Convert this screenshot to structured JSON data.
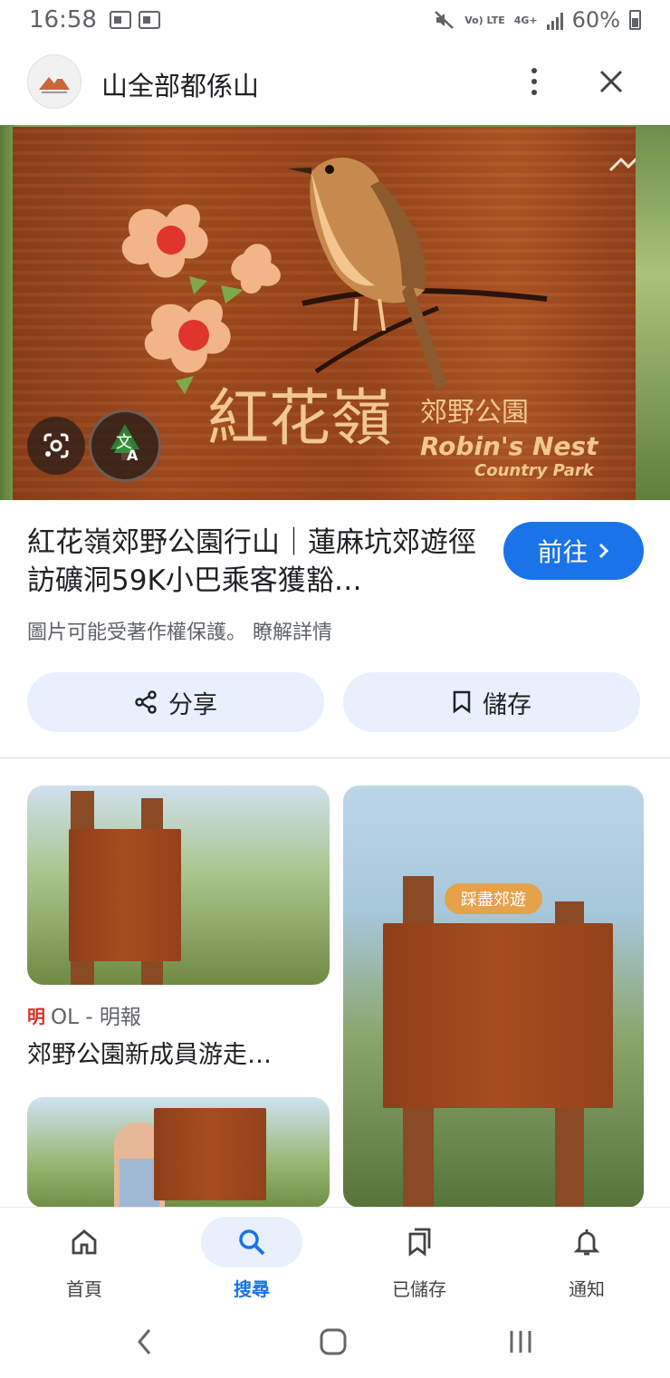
{
  "status_bar": {
    "time": "16:58",
    "lte_label": "Vo) LTE",
    "net_label": "4G+",
    "battery": "60%"
  },
  "header": {
    "site_name": "山全部都係山",
    "icons": [
      "site-logo-icon",
      "more-vert-icon",
      "close-icon"
    ]
  },
  "hero": {
    "image_alt": "紅花嶺郊野公園 Robin's Nest Country Park wooden sign",
    "sign_title_cn": "紅花嶺",
    "sign_sub_cn": "郊野公園",
    "sign_en_1": "Robin's Nest",
    "sign_en_2": "Country Park",
    "lens_icon": "google-lens-icon",
    "translate_icon": "translate-icon"
  },
  "result": {
    "title": "紅花嶺郊野公園行山｜蓮麻坑郊遊徑訪礦洞59K小巴乘客獲豁…",
    "visit_label": "前往",
    "copyright_text": "圖片可能受著作權保護。",
    "learn_more": "瞭解詳情"
  },
  "actions": {
    "share_label": "分享",
    "save_label": "儲存"
  },
  "related": {
    "card1": {
      "source_icon": "明",
      "source": "OL - 明報",
      "title": "郊野公園新成員游走…"
    },
    "card2": {
      "banner": "踩盡郊遊"
    }
  },
  "bottom_nav": [
    {
      "label": "首頁",
      "icon": "home-icon",
      "active": false
    },
    {
      "label": "搜尋",
      "icon": "search-icon",
      "active": true
    },
    {
      "label": "已儲存",
      "icon": "saved-icon",
      "active": false
    },
    {
      "label": "通知",
      "icon": "bell-icon",
      "active": false
    }
  ],
  "colors": {
    "accent": "#1a73e8",
    "chip_bg": "#e8f0fe",
    "wood": "#a34c1f"
  }
}
